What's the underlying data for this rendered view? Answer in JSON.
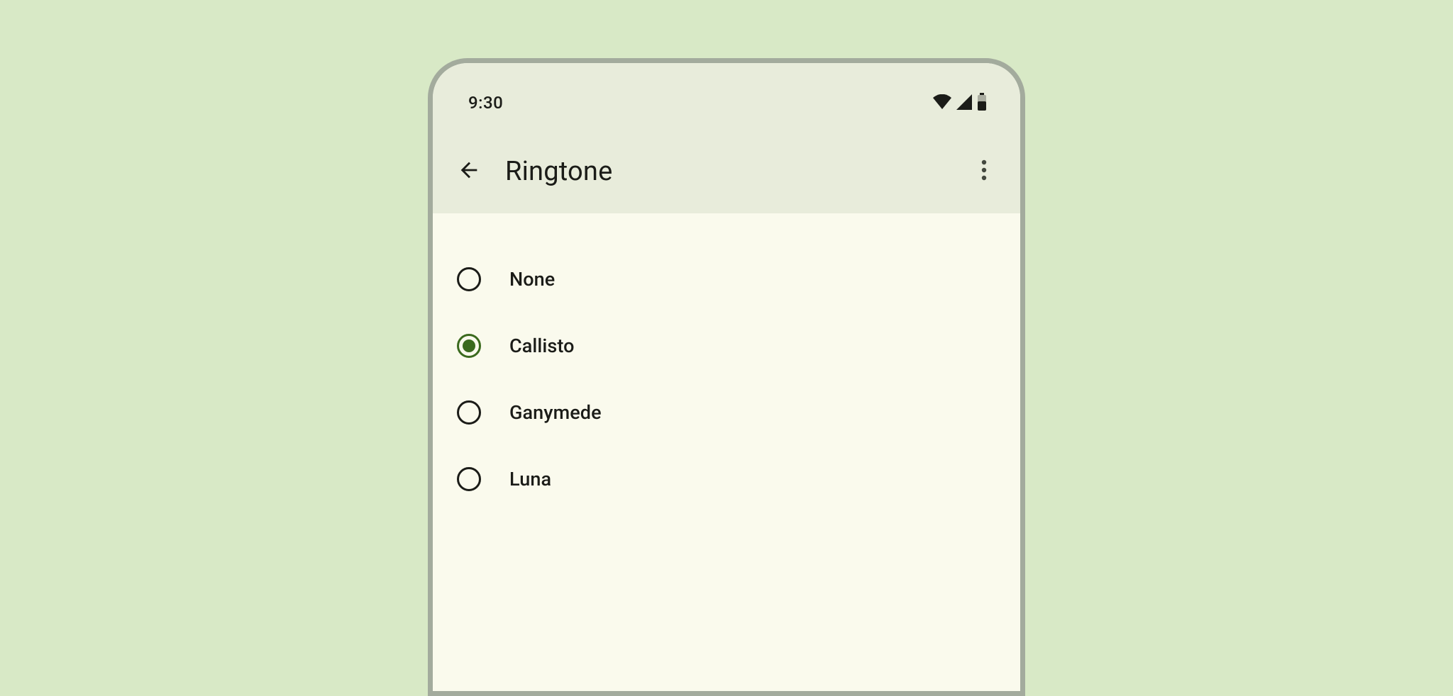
{
  "status": {
    "time": "9:30"
  },
  "header": {
    "title": "Ringtone"
  },
  "options": [
    {
      "label": "None",
      "selected": false
    },
    {
      "label": "Callisto",
      "selected": true
    },
    {
      "label": "Ganymede",
      "selected": false
    },
    {
      "label": "Luna",
      "selected": false
    }
  ],
  "colors": {
    "accent": "#3b6a1e",
    "surface": "#fafaed",
    "surface_variant": "#e8ecdb",
    "page_bg": "#d8e9c6"
  }
}
